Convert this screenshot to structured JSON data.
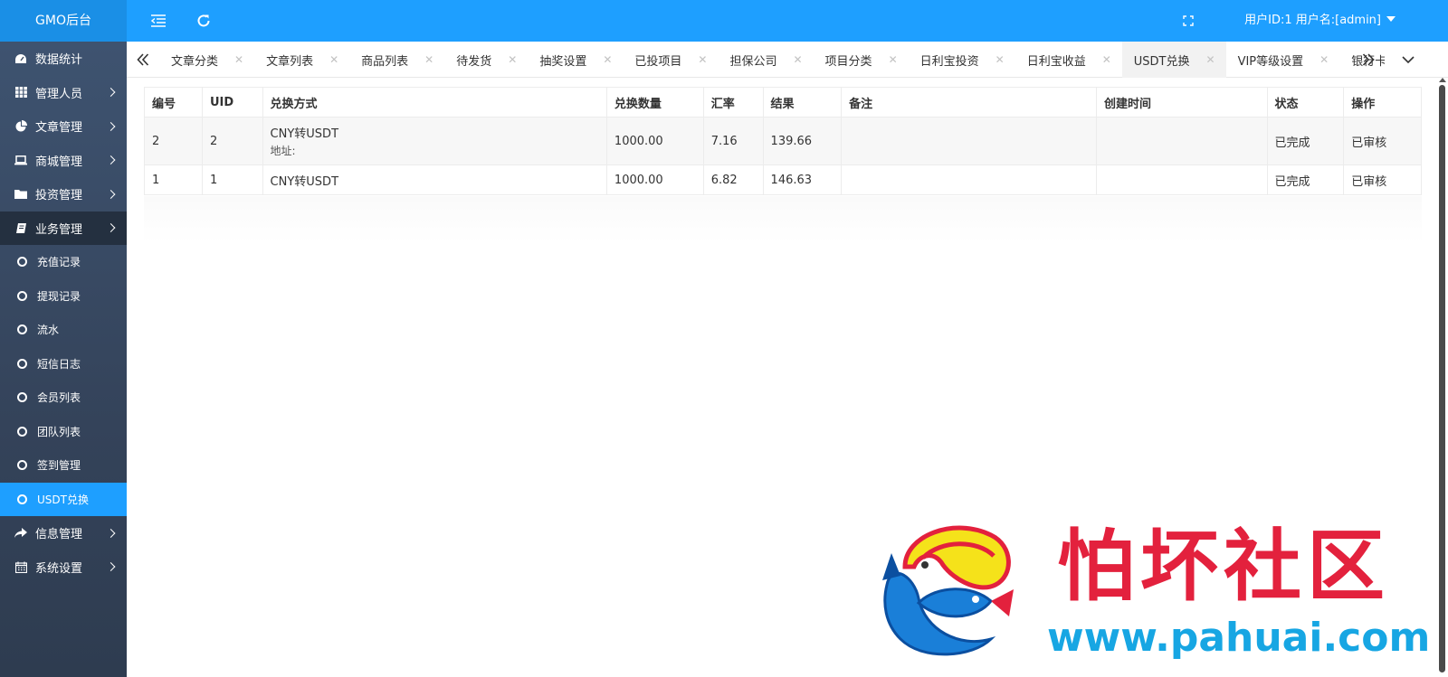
{
  "header": {
    "brand": "GMO后台",
    "user": "用户ID:1 用户名:[admin]"
  },
  "sidebar": {
    "items": [
      {
        "label": "数据统计",
        "icon": "dashboard-icon",
        "has_arrow": false
      },
      {
        "label": "管理人员",
        "icon": "grid-icon",
        "has_arrow": true
      },
      {
        "label": "文章管理",
        "icon": "pie-chart-icon",
        "has_arrow": true
      },
      {
        "label": "商城管理",
        "icon": "laptop-icon",
        "has_arrow": true
      },
      {
        "label": "投资管理",
        "icon": "folder-icon",
        "has_arrow": true
      },
      {
        "label": "业务管理",
        "icon": "book-icon",
        "has_arrow": true
      }
    ],
    "sub_items": [
      "充值记录",
      "提现记录",
      "流水",
      "短信日志",
      "会员列表",
      "团队列表",
      "签到管理",
      "USDT兑换"
    ],
    "items_after": [
      {
        "label": "信息管理",
        "icon": "share-icon",
        "has_arrow": true
      },
      {
        "label": "系统设置",
        "icon": "calendar-icon",
        "has_arrow": true
      }
    ]
  },
  "tabs": [
    "文章分类",
    "文章列表",
    "商品列表",
    "待发货",
    "抽奖设置",
    "已投项目",
    "担保公司",
    "项目分类",
    "日利宝投资",
    "日利宝收益",
    "USDT兑换",
    "VIP等级设置",
    "银行卡"
  ],
  "active_tab": "USDT兑换",
  "table": {
    "headers": [
      "编号",
      "UID",
      "兑换方式",
      "兑换数量",
      "汇率",
      "结果",
      "备注",
      "创建时间",
      "状态",
      "操作"
    ],
    "rows": [
      {
        "id": "2",
        "uid": "2",
        "method": "CNY转USDT",
        "address_label": "地址:",
        "amount": "1000.00",
        "rate": "7.16",
        "result": "139.66",
        "note": "",
        "created": "",
        "status": "已完成",
        "action": "已审核"
      },
      {
        "id": "1",
        "uid": "1",
        "method": "CNY转USDT",
        "address_label": "",
        "amount": "1000.00",
        "rate": "6.82",
        "result": "146.63",
        "note": "",
        "created": "",
        "status": "已完成",
        "action": "已审核"
      }
    ]
  },
  "watermark": {
    "title": "怕坏社区",
    "url": "www.pahuai.com"
  },
  "colors": {
    "primary": "#1e9fff",
    "sidebar": "#3a4a60",
    "watermark_red": "#e3213d",
    "watermark_blue": "#17a6e3"
  }
}
